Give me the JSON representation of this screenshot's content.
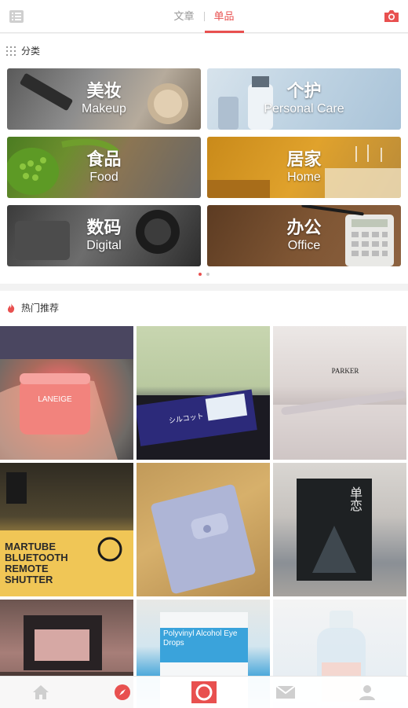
{
  "header": {
    "tabs": [
      {
        "label": "文章",
        "active": false
      },
      {
        "label": "单品",
        "active": true
      }
    ]
  },
  "categories": {
    "title": "分类",
    "items": [
      {
        "cn": "美妆",
        "en": "Makeup"
      },
      {
        "cn": "个护",
        "en": "Personal Care"
      },
      {
        "cn": "食品",
        "en": "Food"
      },
      {
        "cn": "居家",
        "en": "Home"
      },
      {
        "cn": "数码",
        "en": "Digital"
      },
      {
        "cn": "办公",
        "en": "Office"
      }
    ],
    "page_indicator": {
      "pages": 2,
      "current": 1
    }
  },
  "hot": {
    "title": "热门推荐",
    "items": [
      {
        "caption_brand": "LANEIGE"
      },
      {
        "caption_brand": "シルコット"
      },
      {
        "caption_brand": "PARKER"
      },
      {
        "caption_brand": "MARTUBE BLUETOOTH REMOTE SHUTTER"
      },
      {
        "caption_brand": ""
      },
      {
        "caption_brand": "单恋"
      },
      {
        "caption_brand": ""
      },
      {
        "caption_brand": "Polyvinyl Alcohol Eye Drops"
      },
      {
        "caption_brand": ""
      }
    ]
  },
  "colors": {
    "accent": "#e8504f"
  }
}
